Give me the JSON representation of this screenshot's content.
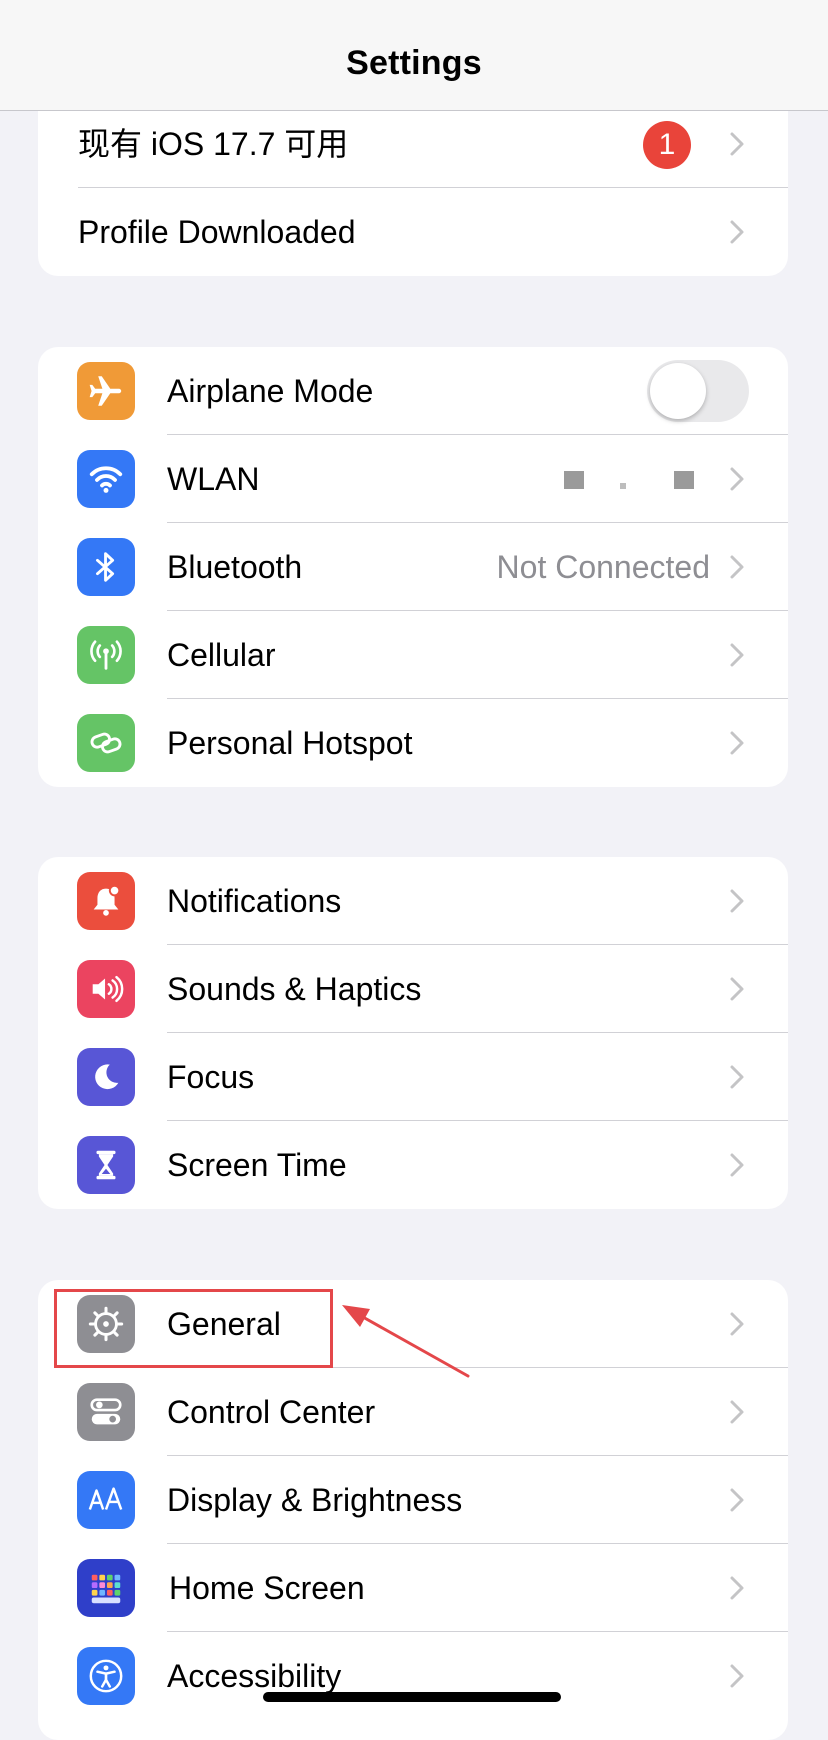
{
  "nav": {
    "title": "Settings"
  },
  "group_top": {
    "update": {
      "label": "现有 iOS 17.7 可用",
      "badge": "1"
    },
    "profile": {
      "label": "Profile Downloaded"
    }
  },
  "group_connectivity": {
    "airplane": {
      "label": "Airplane Mode",
      "icon": "airplane-icon",
      "color": "#f09a37",
      "toggle_on": false
    },
    "wlan": {
      "label": "WLAN",
      "icon": "wifi-icon",
      "color": "#3478f6"
    },
    "bluetooth": {
      "label": "Bluetooth",
      "value": "Not Connected",
      "icon": "bluetooth-icon",
      "color": "#3478f6"
    },
    "cellular": {
      "label": "Cellular",
      "icon": "cellular-antenna-icon",
      "color": "#65c466"
    },
    "hotspot": {
      "label": "Personal Hotspot",
      "icon": "hotspot-link-icon",
      "color": "#65c466"
    }
  },
  "group_attention": {
    "notifications": {
      "label": "Notifications",
      "icon": "bell-icon",
      "color": "#eb4e3d"
    },
    "sounds": {
      "label": "Sounds & Haptics",
      "icon": "speaker-icon",
      "color": "#eb4460"
    },
    "focus": {
      "label": "Focus",
      "icon": "moon-icon",
      "color": "#5856d6"
    },
    "screentime": {
      "label": "Screen Time",
      "icon": "hourglass-icon",
      "color": "#5856d6"
    }
  },
  "group_system": {
    "general": {
      "label": "General",
      "icon": "gear-icon",
      "color": "#8e8e93"
    },
    "control_center": {
      "label": "Control Center",
      "icon": "toggles-icon",
      "color": "#8e8e93"
    },
    "display": {
      "label": "Display & Brightness",
      "icon": "text-size-icon",
      "color": "#3478f6"
    },
    "home_screen": {
      "label": "Home Screen",
      "icon": "app-grid-icon",
      "color": "#2f3fc9"
    },
    "accessibility": {
      "label": "Accessibility",
      "icon": "accessibility-person-icon",
      "color": "#3478f6"
    }
  },
  "annotation": {
    "color": "#e4474a",
    "target": "General"
  }
}
